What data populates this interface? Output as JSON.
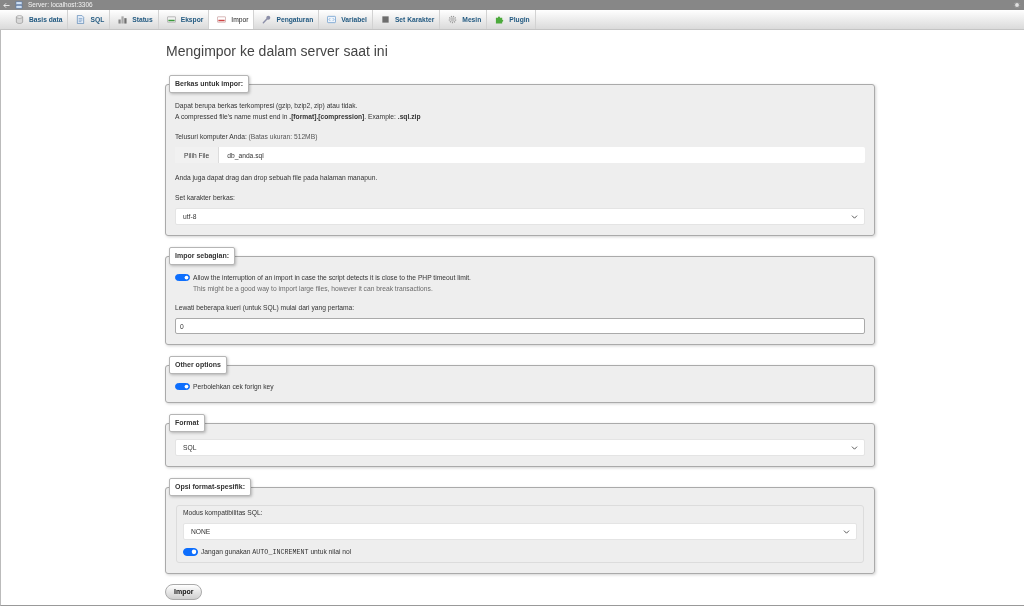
{
  "window": {
    "title": "Server: localhost:3306"
  },
  "tabs": [
    {
      "label": "Basis data",
      "kind": "database",
      "selected": false
    },
    {
      "label": "SQL",
      "kind": "sql",
      "selected": false
    },
    {
      "label": "Status",
      "kind": "status",
      "selected": false
    },
    {
      "label": "Ekspor",
      "kind": "export",
      "selected": false
    },
    {
      "label": "Impor",
      "kind": "import",
      "selected": true
    },
    {
      "label": "Pengaturan",
      "kind": "settings",
      "selected": false
    },
    {
      "label": "Variabel",
      "kind": "variables",
      "selected": false
    },
    {
      "label": "Set Karakter",
      "kind": "charset",
      "selected": false
    },
    {
      "label": "Mesin",
      "kind": "engines",
      "selected": false
    },
    {
      "label": "Plugin",
      "kind": "plugins",
      "selected": false
    }
  ],
  "page_title": "Mengimpor ke dalam server saat ini",
  "sections": [
    {
      "legend": "Berkas untuk impor:",
      "items": [
        {
          "kind": "text",
          "text": "Dapat berupa berkas terkompresi (gzip, bzip2, zip) atau tidak."
        },
        {
          "kind": "text",
          "text": "A compressed file's name must end in **.[format].[compression]**. Example: **.sql.zip**"
        },
        {
          "kind": "label",
          "text": "Telusuri komputer Anda:",
          "note": "(Batas ukuran: 512MB)"
        },
        {
          "kind": "file",
          "button": "Pilih File",
          "value": "db_anda.sql"
        },
        {
          "kind": "text",
          "text": "Anda juga dapat drag dan drop sebuah file pada halaman manapun."
        },
        {
          "kind": "label",
          "text": "Set karakter berkas:"
        },
        {
          "kind": "select",
          "value": "utf-8"
        }
      ]
    },
    {
      "legend": "Impor sebagian:",
      "items": [
        {
          "kind": "toggle",
          "label": "Allow the interruption of an import in case the script detects it is close to the PHP timeout limit.",
          "hint": "This might be a good way to import large files, however it can break transactions.",
          "on": true
        },
        {
          "kind": "label",
          "text": "Lewati beberapa kueri (untuk SQL) mulai dari yang pertama:"
        },
        {
          "kind": "input",
          "value": "0"
        }
      ]
    },
    {
      "legend": "Other options",
      "items": [
        {
          "kind": "toggle",
          "label": "Perbolehkan cek forign key",
          "on": true
        }
      ]
    },
    {
      "legend": "Format",
      "items": [
        {
          "kind": "select",
          "value": "SQL"
        }
      ]
    },
    {
      "legend": "Opsi format-spesifik:",
      "items": [
        {
          "kind": "group",
          "items": [
            {
              "kind": "label",
              "text": "Modus kompatibilitas SQL:"
            },
            {
              "kind": "select",
              "value": "NONE"
            },
            {
              "kind": "toggle",
              "label_parts": [
                {
                  "text": "Jangan gunakan",
                  "code": false
                },
                {
                  "text": "AUTO_INCREMENT",
                  "code": true
                },
                {
                  "text": "untuk nilai nol",
                  "code": false
                }
              ],
              "on": true
            }
          ]
        }
      ]
    }
  ],
  "submit_button": "Impor"
}
